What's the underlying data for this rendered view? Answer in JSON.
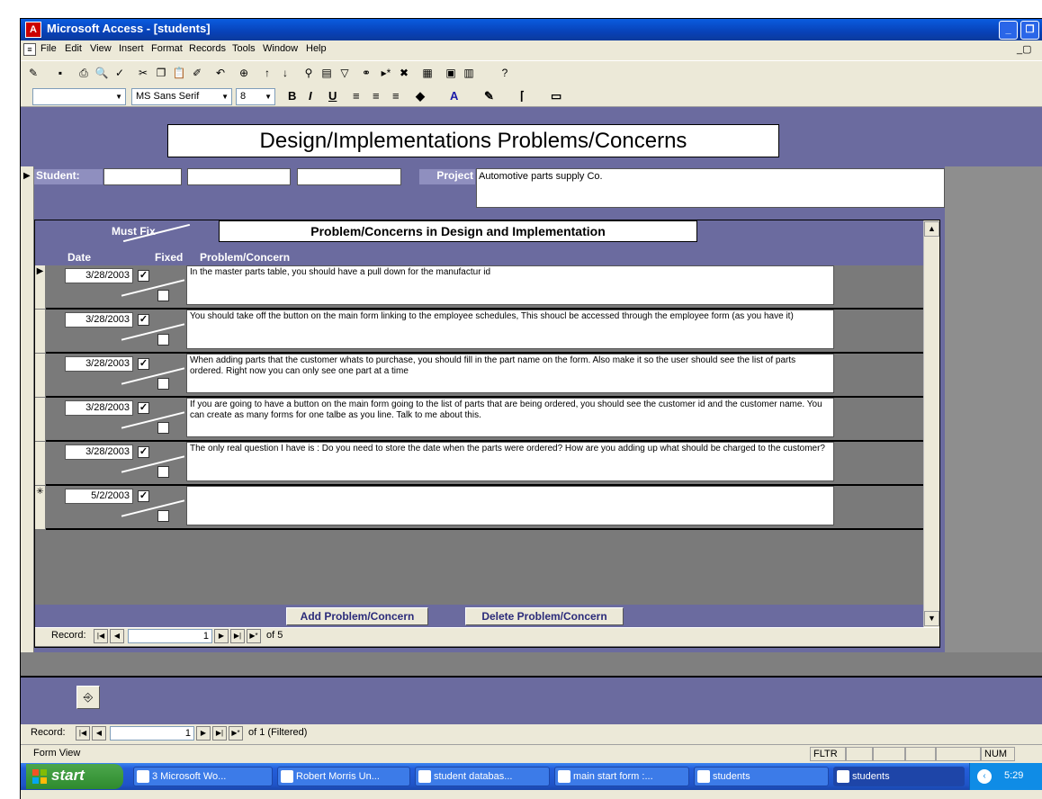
{
  "window": {
    "title": "Microsoft Access - [students]"
  },
  "menu": [
    "File",
    "Edit",
    "View",
    "Insert",
    "Format",
    "Records",
    "Tools",
    "Window",
    "Help"
  ],
  "format_toolbar": {
    "object": "",
    "font": "MS Sans Serif",
    "size": "8"
  },
  "form": {
    "title": "Design/Implementations Problems/Concerns",
    "student_label": "Student:",
    "student_fields": [
      "",
      "",
      ""
    ],
    "project_label": "Project",
    "project_value": "Automotive parts supply Co."
  },
  "subform": {
    "title": "Problem/Concerns in Design and Implementation",
    "header": {
      "must_fix": "Must Fix",
      "date": "Date",
      "fixed": "Fixed",
      "problem": "Problem/Concern"
    },
    "rows": [
      {
        "date": "3/28/2003",
        "must_fix": true,
        "fixed": false,
        "text": "In the master parts table, you should have a pull down for the manufactur id"
      },
      {
        "date": "3/28/2003",
        "must_fix": true,
        "fixed": false,
        "text": "You should take off the button on the main form linking to the employee schedules, This shoucl be accessed through the employee form (as you have it)"
      },
      {
        "date": "3/28/2003",
        "must_fix": true,
        "fixed": false,
        "text": "When adding parts that the customer whats to purchase, you should fill in the part name on the form.  Also make it so the user should see the list of parts ordered.  Right now you can only see one part at a time"
      },
      {
        "date": "3/28/2003",
        "must_fix": true,
        "fixed": false,
        "text": "If you are going to have a button on the main form going to the list of parts that are being ordered, you should see the customer id and the customer name.  You can create as many forms for one talbe as you line.  Talk to me about this."
      },
      {
        "date": "3/28/2003",
        "must_fix": true,
        "fixed": false,
        "text": "The only real question I have is : Do you need to store the date when the parts were ordered?  How are you adding up what should be charged to the customer?"
      },
      {
        "date": "5/2/2003",
        "must_fix": true,
        "fixed": false,
        "text": ""
      }
    ],
    "add_button": "Add Problem/Concern",
    "delete_button": "Delete Problem/Concern",
    "nav": {
      "label": "Record:",
      "current": "1",
      "of": "of  5"
    }
  },
  "main_nav": {
    "label": "Record:",
    "current": "1",
    "of": "of  1 (Filtered)"
  },
  "status": {
    "mode": "Form View",
    "fltr": "FLTR",
    "num": "NUM"
  },
  "taskbar": {
    "start": "start",
    "tasks": [
      "3 Microsoft Wo...",
      "Robert Morris Un...",
      "student databas...",
      "main start form :...",
      "students",
      "students"
    ],
    "clock": "5:29"
  }
}
